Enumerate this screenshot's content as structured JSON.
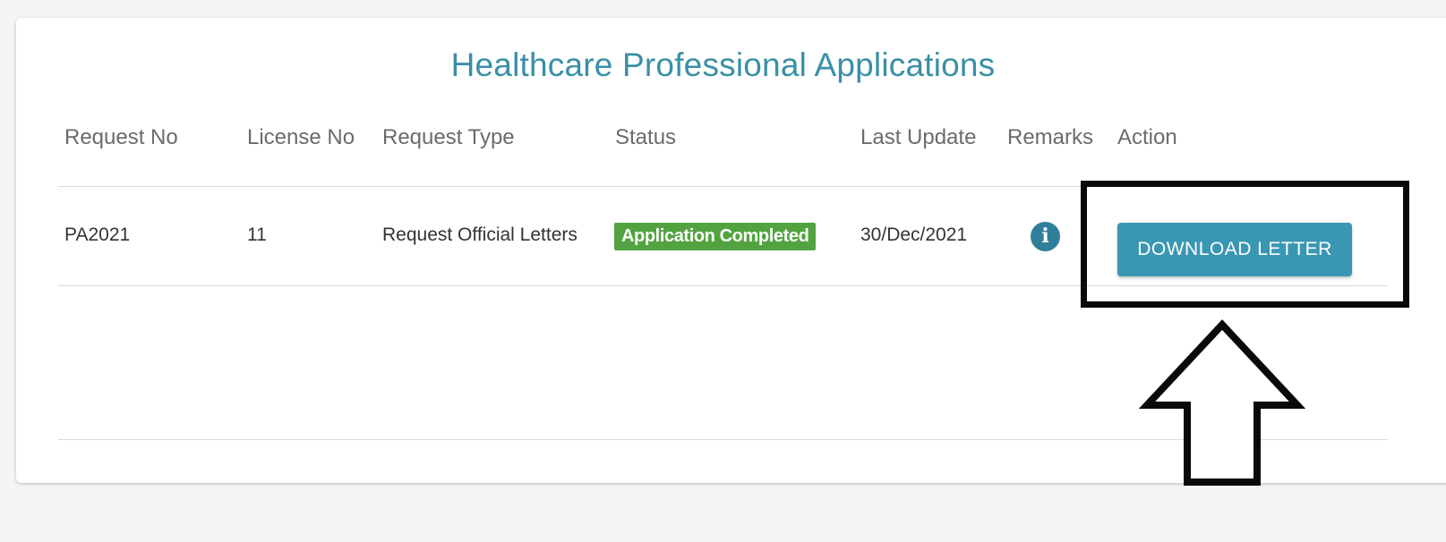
{
  "title": "Healthcare Professional Applications",
  "table": {
    "headers": {
      "request_no": "Request No",
      "license_no": "License No",
      "request_type": "Request Type",
      "status": "Status",
      "last_update": "Last Update",
      "remarks": "Remarks",
      "action": "Action"
    },
    "rows": [
      {
        "request_no": "PA2021",
        "license_no": "11",
        "request_type": "Request Official Letters",
        "status": "Application Completed",
        "last_update": "30/Dec/2021",
        "remarks_icon": "info-icon",
        "action_label": "DOWNLOAD LETTER"
      }
    ]
  },
  "colors": {
    "title": "#3a8fa6",
    "status_badge": "#52a340",
    "info_icon": "#2f7f9b",
    "button": "#3a97b3",
    "highlight": "#0a0a0a"
  },
  "annotations": {
    "highlight": "highlight-box",
    "pointer": "up-arrow"
  }
}
